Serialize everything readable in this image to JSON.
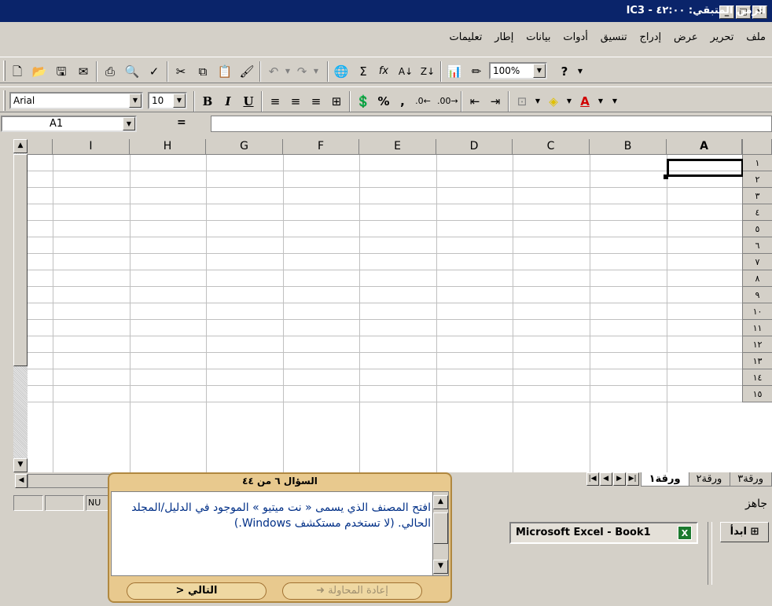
{
  "title": {
    "text": "الزمن المتبقي: ٤٢:٠٠ - IC3"
  },
  "window_buttons": {
    "minimize": "_",
    "maximize": "□",
    "close": "×"
  },
  "menu": [
    "ملف",
    "تحرير",
    "عرض",
    "إدراج",
    "تنسيق",
    "أدوات",
    "بيانات",
    "إطار",
    "تعليمات"
  ],
  "toolbar": {
    "zoom": "100%"
  },
  "format": {
    "font": "Arial",
    "size": "10",
    "bold": "B",
    "italic": "I",
    "underline": "U",
    "percent": "%",
    "comma": ","
  },
  "formula": {
    "name_box": "A1",
    "equals": "="
  },
  "grid": {
    "columns": [
      "A",
      "B",
      "C",
      "D",
      "E",
      "F",
      "G",
      "H",
      "I"
    ],
    "rows": [
      "١",
      "٢",
      "٣",
      "٤",
      "٥",
      "٦",
      "٧",
      "٨",
      "٩",
      "١٠",
      "١١",
      "١٢",
      "١٣",
      "١٤",
      "١٥"
    ]
  },
  "sheets": [
    "ورقة١",
    "ورقة٢",
    "ورقة٣"
  ],
  "status": {
    "ready": "جاهز",
    "num": "NU"
  },
  "taskbar": {
    "start": "ابدأ",
    "task": "Microsoft Excel - Book1"
  },
  "question": {
    "header": "السؤال ٦ من ٤٤",
    "text": "افتح المصنف الذي يسمى « نت ميتيو » الموجود في الدليل/المجلد الحالي. (لا تستخدم مستكشف Windows.)",
    "retry": "إعادة المحاولة",
    "next": "التالي"
  }
}
